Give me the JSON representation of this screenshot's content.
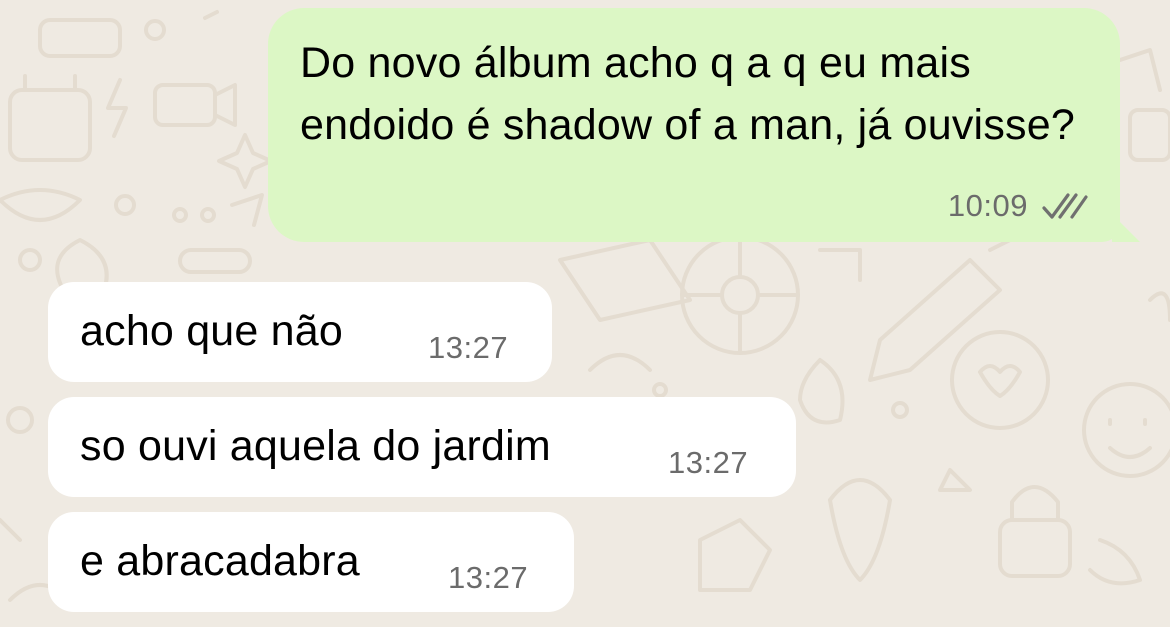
{
  "chat": {
    "messages": [
      {
        "direction": "outgoing",
        "text": "Do novo álbum acho q a q eu mais endoido é shadow of a man, já ouvisse?",
        "time": "10:09",
        "status_icon": "double-check-read-icon"
      },
      {
        "direction": "incoming",
        "text": "acho que não",
        "time": "13:27"
      },
      {
        "direction": "incoming",
        "text": "so ouvi aquela do jardim",
        "time": "13:27"
      },
      {
        "direction": "incoming",
        "text": "e abracadabra",
        "time": "13:27"
      }
    ]
  },
  "colors": {
    "background": "#EFEAE2",
    "wallpaper_doodles": "#E4DCD0",
    "outgoing_bubble": "#DCF7C5",
    "incoming_bubble": "#FFFFFF",
    "timestamp": "#6B6B6B"
  }
}
